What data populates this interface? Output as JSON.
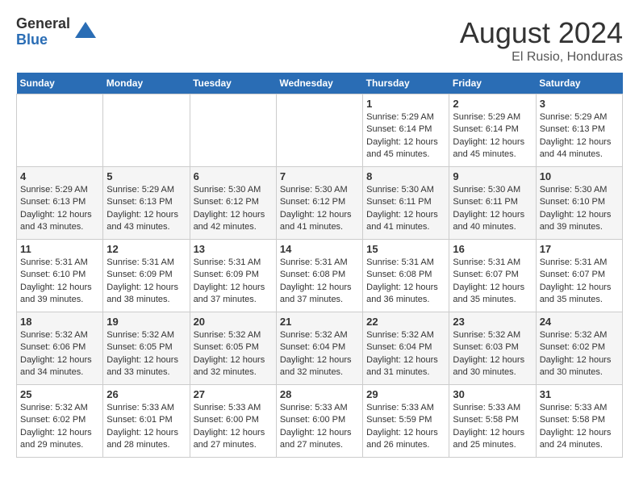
{
  "header": {
    "logo_general": "General",
    "logo_blue": "Blue",
    "month_year": "August 2024",
    "location": "El Rusio, Honduras"
  },
  "weekdays": [
    "Sunday",
    "Monday",
    "Tuesday",
    "Wednesday",
    "Thursday",
    "Friday",
    "Saturday"
  ],
  "weeks": [
    [
      {
        "day": "",
        "info": ""
      },
      {
        "day": "",
        "info": ""
      },
      {
        "day": "",
        "info": ""
      },
      {
        "day": "",
        "info": ""
      },
      {
        "day": "1",
        "info": "Sunrise: 5:29 AM\nSunset: 6:14 PM\nDaylight: 12 hours\nand 45 minutes."
      },
      {
        "day": "2",
        "info": "Sunrise: 5:29 AM\nSunset: 6:14 PM\nDaylight: 12 hours\nand 45 minutes."
      },
      {
        "day": "3",
        "info": "Sunrise: 5:29 AM\nSunset: 6:13 PM\nDaylight: 12 hours\nand 44 minutes."
      }
    ],
    [
      {
        "day": "4",
        "info": "Sunrise: 5:29 AM\nSunset: 6:13 PM\nDaylight: 12 hours\nand 43 minutes."
      },
      {
        "day": "5",
        "info": "Sunrise: 5:29 AM\nSunset: 6:13 PM\nDaylight: 12 hours\nand 43 minutes."
      },
      {
        "day": "6",
        "info": "Sunrise: 5:30 AM\nSunset: 6:12 PM\nDaylight: 12 hours\nand 42 minutes."
      },
      {
        "day": "7",
        "info": "Sunrise: 5:30 AM\nSunset: 6:12 PM\nDaylight: 12 hours\nand 41 minutes."
      },
      {
        "day": "8",
        "info": "Sunrise: 5:30 AM\nSunset: 6:11 PM\nDaylight: 12 hours\nand 41 minutes."
      },
      {
        "day": "9",
        "info": "Sunrise: 5:30 AM\nSunset: 6:11 PM\nDaylight: 12 hours\nand 40 minutes."
      },
      {
        "day": "10",
        "info": "Sunrise: 5:30 AM\nSunset: 6:10 PM\nDaylight: 12 hours\nand 39 minutes."
      }
    ],
    [
      {
        "day": "11",
        "info": "Sunrise: 5:31 AM\nSunset: 6:10 PM\nDaylight: 12 hours\nand 39 minutes."
      },
      {
        "day": "12",
        "info": "Sunrise: 5:31 AM\nSunset: 6:09 PM\nDaylight: 12 hours\nand 38 minutes."
      },
      {
        "day": "13",
        "info": "Sunrise: 5:31 AM\nSunset: 6:09 PM\nDaylight: 12 hours\nand 37 minutes."
      },
      {
        "day": "14",
        "info": "Sunrise: 5:31 AM\nSunset: 6:08 PM\nDaylight: 12 hours\nand 37 minutes."
      },
      {
        "day": "15",
        "info": "Sunrise: 5:31 AM\nSunset: 6:08 PM\nDaylight: 12 hours\nand 36 minutes."
      },
      {
        "day": "16",
        "info": "Sunrise: 5:31 AM\nSunset: 6:07 PM\nDaylight: 12 hours\nand 35 minutes."
      },
      {
        "day": "17",
        "info": "Sunrise: 5:31 AM\nSunset: 6:07 PM\nDaylight: 12 hours\nand 35 minutes."
      }
    ],
    [
      {
        "day": "18",
        "info": "Sunrise: 5:32 AM\nSunset: 6:06 PM\nDaylight: 12 hours\nand 34 minutes."
      },
      {
        "day": "19",
        "info": "Sunrise: 5:32 AM\nSunset: 6:05 PM\nDaylight: 12 hours\nand 33 minutes."
      },
      {
        "day": "20",
        "info": "Sunrise: 5:32 AM\nSunset: 6:05 PM\nDaylight: 12 hours\nand 32 minutes."
      },
      {
        "day": "21",
        "info": "Sunrise: 5:32 AM\nSunset: 6:04 PM\nDaylight: 12 hours\nand 32 minutes."
      },
      {
        "day": "22",
        "info": "Sunrise: 5:32 AM\nSunset: 6:04 PM\nDaylight: 12 hours\nand 31 minutes."
      },
      {
        "day": "23",
        "info": "Sunrise: 5:32 AM\nSunset: 6:03 PM\nDaylight: 12 hours\nand 30 minutes."
      },
      {
        "day": "24",
        "info": "Sunrise: 5:32 AM\nSunset: 6:02 PM\nDaylight: 12 hours\nand 30 minutes."
      }
    ],
    [
      {
        "day": "25",
        "info": "Sunrise: 5:32 AM\nSunset: 6:02 PM\nDaylight: 12 hours\nand 29 minutes."
      },
      {
        "day": "26",
        "info": "Sunrise: 5:33 AM\nSunset: 6:01 PM\nDaylight: 12 hours\nand 28 minutes."
      },
      {
        "day": "27",
        "info": "Sunrise: 5:33 AM\nSunset: 6:00 PM\nDaylight: 12 hours\nand 27 minutes."
      },
      {
        "day": "28",
        "info": "Sunrise: 5:33 AM\nSunset: 6:00 PM\nDaylight: 12 hours\nand 27 minutes."
      },
      {
        "day": "29",
        "info": "Sunrise: 5:33 AM\nSunset: 5:59 PM\nDaylight: 12 hours\nand 26 minutes."
      },
      {
        "day": "30",
        "info": "Sunrise: 5:33 AM\nSunset: 5:58 PM\nDaylight: 12 hours\nand 25 minutes."
      },
      {
        "day": "31",
        "info": "Sunrise: 5:33 AM\nSunset: 5:58 PM\nDaylight: 12 hours\nand 24 minutes."
      }
    ]
  ]
}
